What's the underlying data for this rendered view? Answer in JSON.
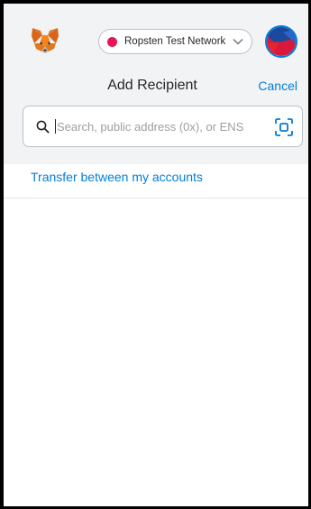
{
  "header": {
    "logo_icon": "metamask-fox-icon",
    "network": {
      "label": "Ropsten Test Network",
      "status_color": "#e91550",
      "icon": "chevron-down-icon"
    },
    "avatar_icon": "account-identicon"
  },
  "page": {
    "title": "Add Recipient",
    "cancel_label": "Cancel"
  },
  "search": {
    "icon": "search-icon",
    "placeholder": "Search, public address (0x), or ENS",
    "value": "",
    "scan_icon": "qr-scan-icon"
  },
  "transfer_link": "Transfer between my accounts",
  "colors": {
    "accent": "#037dd6",
    "header_bg": "#f2f3f4",
    "network_dot": "#e91550"
  }
}
